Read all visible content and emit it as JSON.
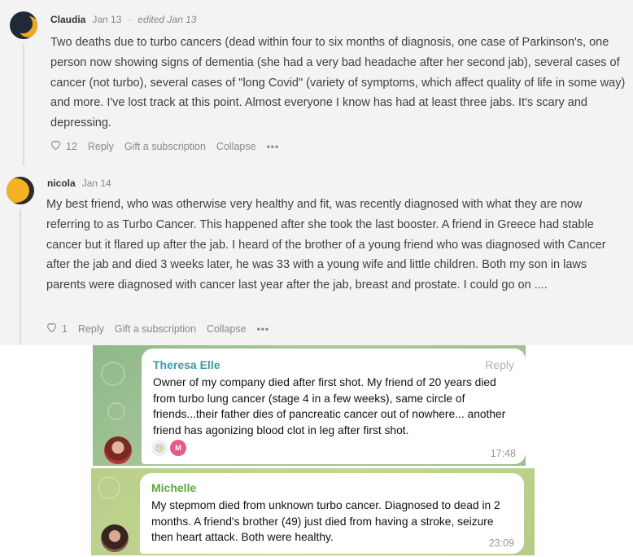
{
  "comments": [
    {
      "author": "Claudia",
      "date": "Jan 13",
      "separator": "·",
      "edited": "edited Jan 13",
      "text": "Two deaths due to turbo cancers (dead within four to six months of diagnosis, one case of Parkinson's, one person now showing signs of dementia (she had a very bad headache after her second jab), several cases of cancer (not turbo), several cases of \"long Covid\" (variety of symptoms, which affect quality of life in some way) and more. I've lost track at this point. Almost everyone I know has had at least three jabs. It's scary and depressing.",
      "likes": "12",
      "reply": "Reply",
      "gift": "Gift a subscription",
      "collapse": "Collapse",
      "more": "•••"
    },
    {
      "author": "nicola",
      "date": "Jan 14",
      "text": "My best friend, who was otherwise very healthy and fit, was recently diagnosed with what they are now referring to as Turbo Cancer. This happened after she took the last booster. A friend in Greece had stable cancer but it flared up after the jab. I heard of the brother of a young friend who was diagnosed with Cancer after the jab and died 3 weeks later, he was 33 with a young wife and little children. Both my son in laws parents were diagnosed with cancer last year after the jab, breast and prostate. I could go on ....",
      "likes": "1",
      "reply": "Reply",
      "gift": "Gift a subscription",
      "collapse": "Collapse",
      "more": "•••"
    }
  ],
  "telegram": [
    {
      "sender": "Theresa Elle",
      "reply": "Reply",
      "text": "Owner of my company died after first shot. My friend of 20 years died from turbo lung cancer (stage 4 in a few weeks), same circle of friends...their father dies of pancreatic cancer out of nowhere... another friend has agonizing blood clot in leg after first shot.",
      "time": "17:48",
      "reaction_emoji": "😢",
      "reaction_user": "M",
      "sender_color": "#3a9aa6"
    },
    {
      "sender": "Michelle",
      "text": "My stepmom died from unknown turbo cancer. Diagnosed to dead in 2 months.  A friend's brother (49) just died from having a stroke, seizure then heart attack.  Both were healthy.",
      "time": "23:09",
      "sender_color": "#5aa83a"
    }
  ],
  "icons": {
    "heart": "heart-icon",
    "more": "more-options-icon"
  }
}
